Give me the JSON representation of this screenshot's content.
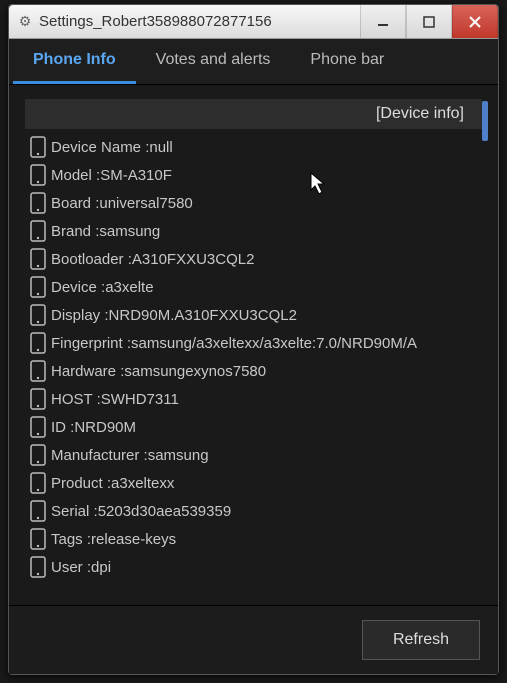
{
  "window": {
    "title": "Settings_Robert358988072877156"
  },
  "tabs": [
    {
      "label": "Phone Info",
      "active": true
    },
    {
      "label": "Votes and alerts",
      "active": false
    },
    {
      "label": "Phone bar",
      "active": false
    }
  ],
  "section_header": "[Device info]",
  "items": [
    {
      "label": "Device Name :",
      "value": "null"
    },
    {
      "label": "Model :",
      "value": "SM-A310F"
    },
    {
      "label": "Board :",
      "value": "universal7580"
    },
    {
      "label": "Brand :",
      "value": "samsung"
    },
    {
      "label": "Bootloader :",
      "value": "A310FXXU3CQL2"
    },
    {
      "label": "Device :",
      "value": "a3xelte"
    },
    {
      "label": "Display :",
      "value": "NRD90M.A310FXXU3CQL2"
    },
    {
      "label": "Fingerprint :",
      "value": "samsung/a3xeltexx/a3xelte:7.0/NRD90M/A"
    },
    {
      "label": "Hardware :",
      "value": "samsungexynos7580"
    },
    {
      "label": "HOST :",
      "value": "SWHD7311"
    },
    {
      "label": "ID :",
      "value": "NRD90M"
    },
    {
      "label": "Manufacturer :",
      "value": "samsung"
    },
    {
      "label": "Product :",
      "value": "a3xeltexx"
    },
    {
      "label": "Serial :",
      "value": "5203d30aea539359"
    },
    {
      "label": "Tags :",
      "value": "release-keys"
    },
    {
      "label": "User :",
      "value": "dpi"
    }
  ],
  "footer": {
    "refresh": "Refresh"
  }
}
